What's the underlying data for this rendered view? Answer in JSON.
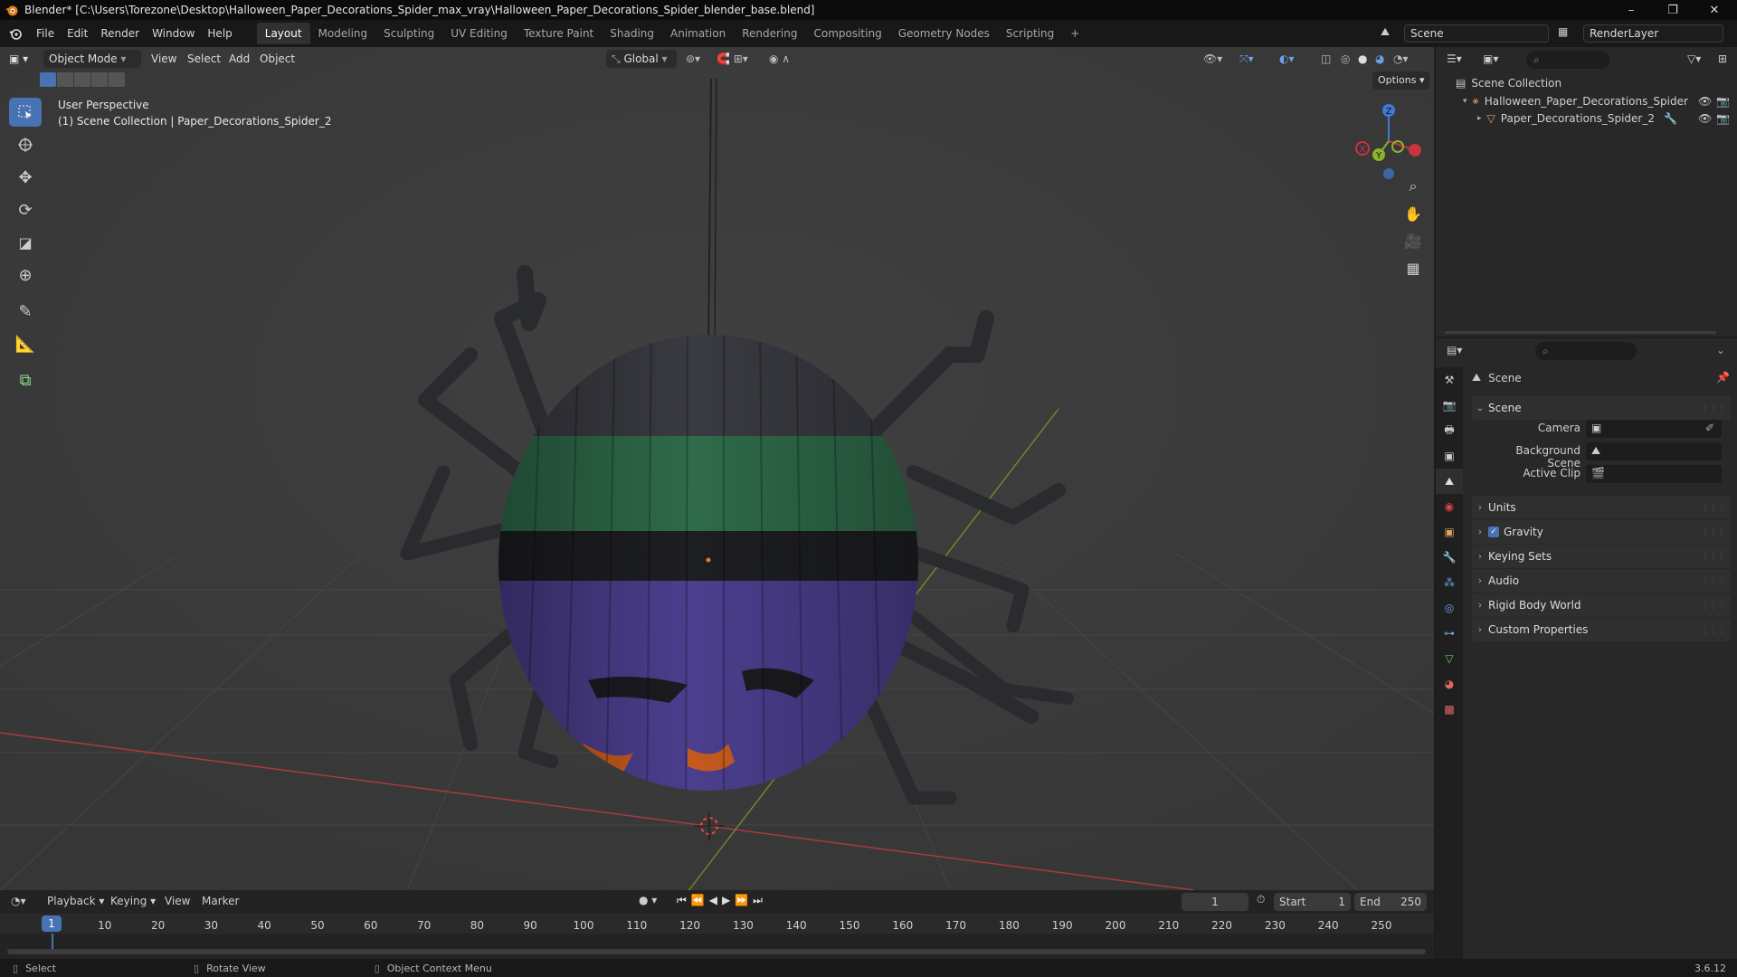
{
  "window": {
    "title": "Blender* [C:\\Users\\Torezone\\Desktop\\Halloween_Paper_Decorations_Spider_max_vray\\Halloween_Paper_Decorations_Spider_blender_base.blend]",
    "minimize": "–",
    "maximize": "❐",
    "close": "✕"
  },
  "menu": [
    "File",
    "Edit",
    "Render",
    "Window",
    "Help"
  ],
  "workspaces": [
    "Layout",
    "Modeling",
    "Sculpting",
    "UV Editing",
    "Texture Paint",
    "Shading",
    "Animation",
    "Rendering",
    "Compositing",
    "Geometry Nodes",
    "Scripting",
    "+"
  ],
  "top_right": {
    "scene": "Scene",
    "render_layer": "RenderLayer"
  },
  "viewport": {
    "mode": "Object Mode",
    "menus": [
      "View",
      "Select",
      "Add",
      "Object"
    ],
    "orientation": "Global",
    "options": "Options",
    "perspective": "User Perspective",
    "collection_info": "(1) Scene Collection | Paper_Decorations_Spider_2",
    "axis_labels": {
      "x": "X",
      "y": "Y",
      "z": "Z"
    }
  },
  "outliner": {
    "root": "Scene Collection",
    "items": [
      {
        "label": "Halloween_Paper_Decorations_Spider"
      },
      {
        "label": "Paper_Decorations_Spider_2"
      }
    ]
  },
  "properties": {
    "title": "Scene",
    "section_scene": "Scene",
    "fields": [
      {
        "label": "Camera"
      },
      {
        "label": "Background Scene"
      },
      {
        "label": "Active Clip"
      }
    ],
    "sections": [
      "Units",
      "Gravity",
      "Keying Sets",
      "Audio",
      "Rigid Body World",
      "Custom Properties"
    ],
    "gravity_checked": true
  },
  "timeline": {
    "menus": [
      "Playback",
      "Keying",
      "View",
      "Marker"
    ],
    "current_frame": "1",
    "start_label": "Start",
    "start": "1",
    "end_label": "End",
    "end": "250",
    "ruler_current": "1",
    "ticks": [
      "10",
      "20",
      "30",
      "40",
      "50",
      "60",
      "70",
      "80",
      "90",
      "100",
      "110",
      "120",
      "130",
      "140",
      "150",
      "160",
      "170",
      "180",
      "190",
      "200",
      "210",
      "220",
      "230",
      "240",
      "250"
    ]
  },
  "statusbar": {
    "select": "Select",
    "rotate": "Rotate View",
    "context": "Object Context Menu",
    "version": "3.6.12"
  },
  "colors": {
    "accent": "#4772b3",
    "x_axis": "#c8333f",
    "y_axis": "#8ab32a",
    "z_axis": "#3e7bd6",
    "spider_green": "#2f6b4a",
    "spider_purple": "#4b3f8e",
    "spider_orange": "#c65a1e"
  }
}
